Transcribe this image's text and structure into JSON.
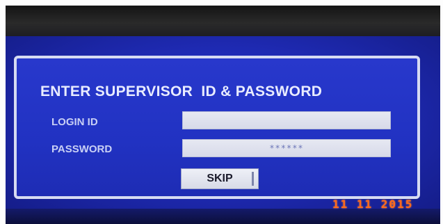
{
  "dialog": {
    "title": "ENTER SUPERVISOR  ID & PASSWORD",
    "login_id_label": "LOGIN ID",
    "login_id_value": "",
    "password_label": "PASSWORD",
    "password_value": "******",
    "skip_label": "SKIP"
  },
  "overlay": {
    "timestamp": "11 11 2015"
  },
  "colors": {
    "screen_blue": "#2132c2",
    "dialog_border": "#d6dbf2",
    "timestamp_orange": "#ff6a1a"
  }
}
